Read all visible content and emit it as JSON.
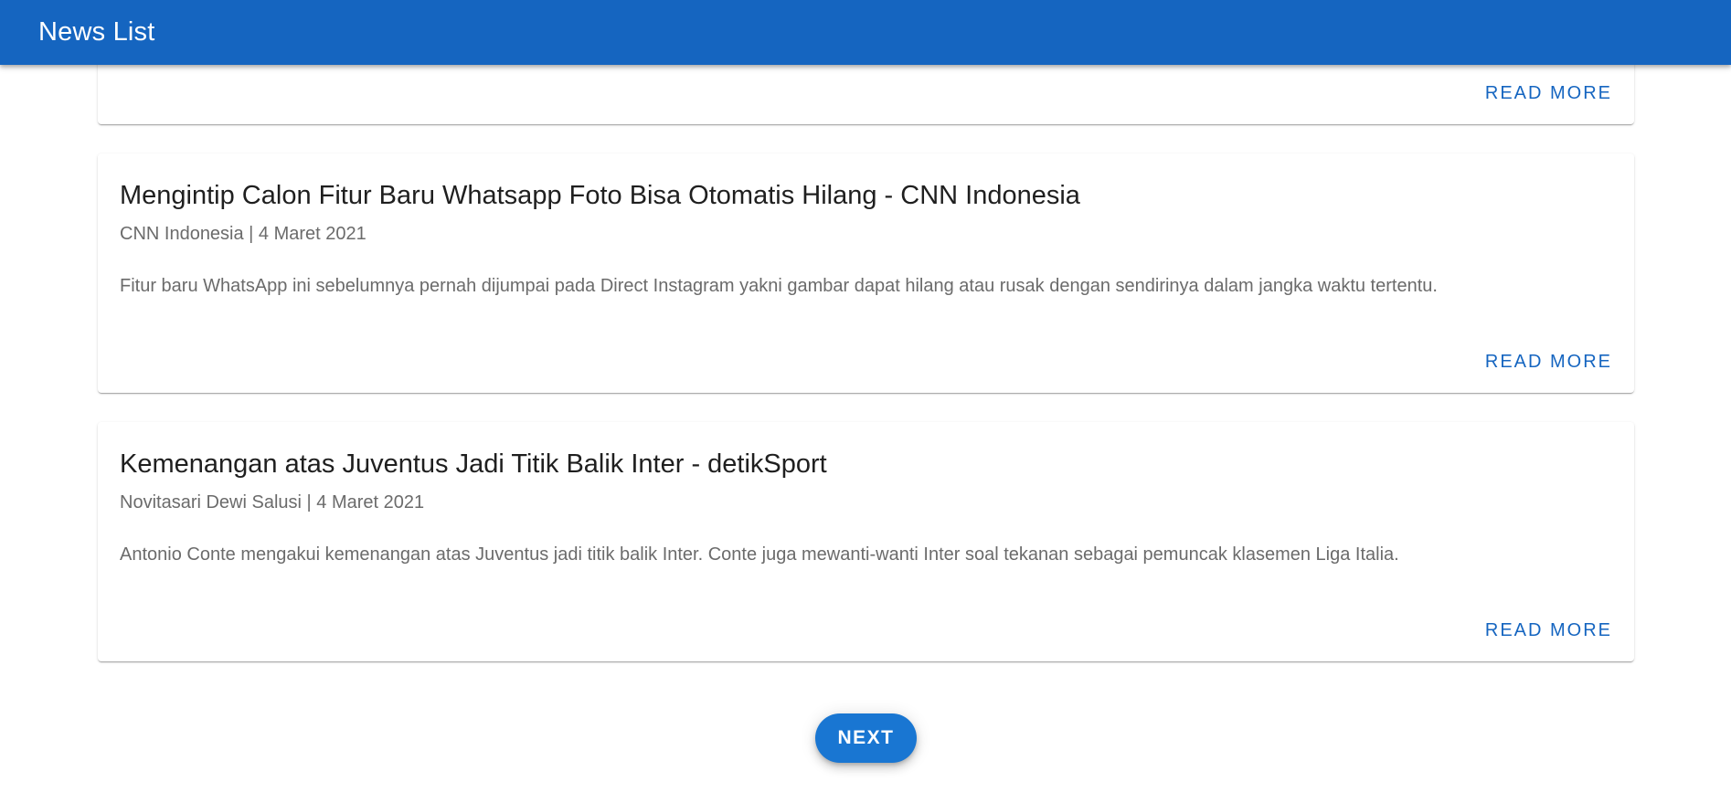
{
  "app_bar": {
    "title": "News List",
    "color": "#1565c0"
  },
  "cards": [
    {
      "read_more_label": "READ MORE"
    },
    {
      "title": "Mengintip Calon Fitur Baru Whatsapp Foto Bisa Otomatis Hilang - CNN Indonesia",
      "meta": "CNN Indonesia | 4 Maret 2021",
      "description": "Fitur baru WhatsApp ini sebelumnya pernah dijumpai pada Direct Instagram yakni gambar dapat hilang atau rusak dengan sendirinya dalam jangka waktu tertentu.",
      "read_more_label": "READ MORE"
    },
    {
      "title": "Kemenangan atas Juventus Jadi Titik Balik Inter - detikSport",
      "meta": "Novitasari Dewi Salusi | 4 Maret 2021",
      "description": "Antonio Conte mengakui kemenangan atas Juventus jadi titik balik Inter. Conte juga mewanti-wanti Inter soal tekanan sebagai pemuncak klasemen Liga Italia.",
      "read_more_label": "READ MORE"
    }
  ],
  "pagination": {
    "next_label": "NEXT"
  },
  "colors": {
    "accent": "#1565c0",
    "button": "#1976d2"
  }
}
